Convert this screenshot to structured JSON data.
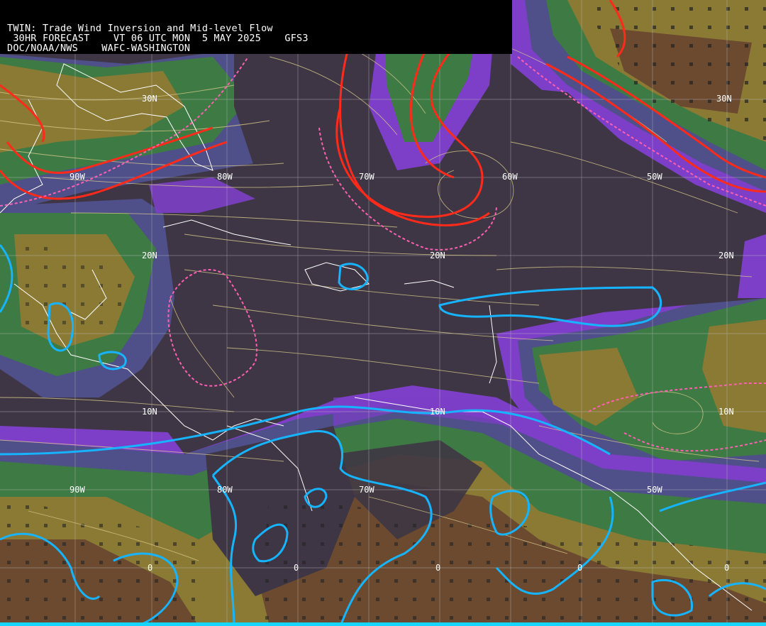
{
  "header": {
    "line1": "TWIN: Trade Wind Inversion and Mid-level Flow",
    "line2": " 30HR FORECAST    VT 06 UTC MON  5 MAY 2025    GFS3",
    "line3": "DOC/NOAA/NWS    WAFC-WASHINGTON"
  },
  "grid_labels": {
    "lat_30n_a": "30N",
    "lat_30n_b": "30N",
    "lat_20n_a": "20N",
    "lat_20n_b": "20N",
    "lat_20n_c": "20N",
    "lat_10n_a": "10N",
    "lat_10n_b": "10N",
    "lat_10n_c": "10N",
    "lon_90w_a": "90W",
    "lon_80w_a": "80W",
    "lon_70w_a": "70W",
    "lon_60w_a": "60W",
    "lon_50w_a": "50W",
    "lon_90w_b": "90W",
    "lon_80w_b": "80W",
    "lon_70w_b": "70W",
    "lon_50w_b": "50W",
    "eq_a": "0",
    "eq_b": "0",
    "eq_c": "0",
    "eq_d": "0",
    "eq_e": "0"
  },
  "colors": {
    "background_dark": "#3e3645",
    "purple": "#7d3fc7",
    "slate_blue": "#4f4f8a",
    "green": "#3d7a44",
    "olive": "#8a7a34",
    "brown": "#6b4a30",
    "streamline": "#d8c98a",
    "red_contour": "#ff2a1a",
    "cyan_contour": "#16b4ff",
    "pink_dashed": "#ff5fb0",
    "coast": "#ffffff"
  }
}
